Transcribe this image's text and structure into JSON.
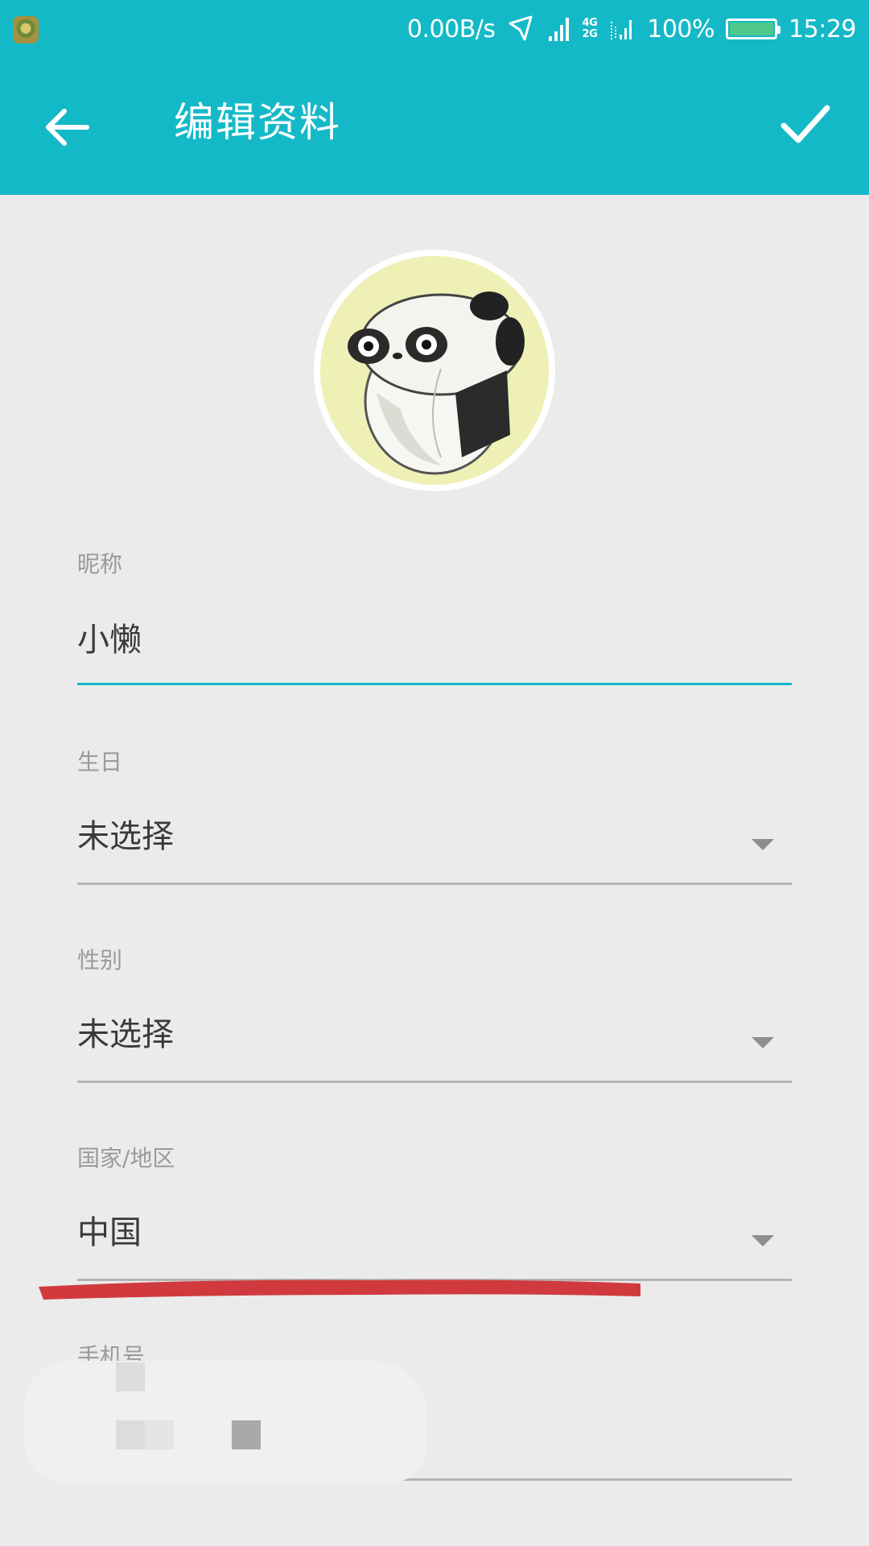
{
  "status_bar": {
    "net_speed": "0.00B/s",
    "network_top": "4G",
    "network_bottom": "2G",
    "battery_percent": "100%",
    "battery_level": 1.0,
    "time": "15:29",
    "icons": [
      "app-icon",
      "vibrate-icon",
      "signal-icon",
      "dual-sim-signal-icon",
      "battery-icon"
    ]
  },
  "toolbar": {
    "title": "编辑资料",
    "back_icon": "arrow-left-icon",
    "confirm_icon": "check-icon",
    "background": "#14b9c7"
  },
  "avatar": {
    "icon": "panda-avatar"
  },
  "form": {
    "nickname": {
      "label": "昵称",
      "value": "小懒"
    },
    "birthday": {
      "label": "生日",
      "value": "未选择"
    },
    "gender": {
      "label": "性别",
      "value": "未选择"
    },
    "region": {
      "label": "国家/地区",
      "value": "中国"
    },
    "phone": {
      "label": "手机号"
    }
  },
  "colors": {
    "accent": "#14b9c7",
    "background": "#ebebeb",
    "underline": "#b5b5b5",
    "annotation_red": "#d03a3e"
  }
}
